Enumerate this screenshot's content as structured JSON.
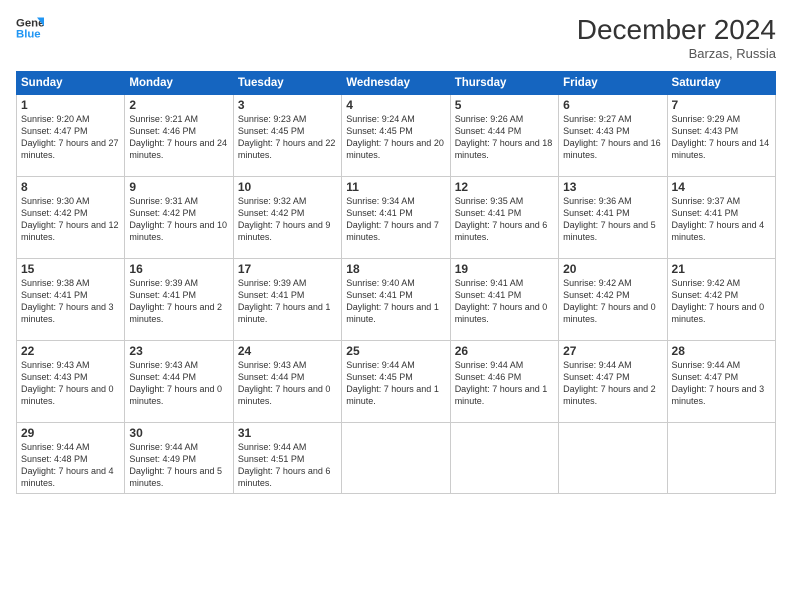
{
  "header": {
    "logo_line1": "General",
    "logo_line2": "Blue",
    "month": "December 2024",
    "location": "Barzas, Russia"
  },
  "weekdays": [
    "Sunday",
    "Monday",
    "Tuesday",
    "Wednesday",
    "Thursday",
    "Friday",
    "Saturday"
  ],
  "weeks": [
    [
      {
        "day": "1",
        "sunrise": "9:20 AM",
        "sunset": "4:47 PM",
        "daylight": "7 hours and 27 minutes."
      },
      {
        "day": "2",
        "sunrise": "9:21 AM",
        "sunset": "4:46 PM",
        "daylight": "7 hours and 24 minutes."
      },
      {
        "day": "3",
        "sunrise": "9:23 AM",
        "sunset": "4:45 PM",
        "daylight": "7 hours and 22 minutes."
      },
      {
        "day": "4",
        "sunrise": "9:24 AM",
        "sunset": "4:45 PM",
        "daylight": "7 hours and 20 minutes."
      },
      {
        "day": "5",
        "sunrise": "9:26 AM",
        "sunset": "4:44 PM",
        "daylight": "7 hours and 18 minutes."
      },
      {
        "day": "6",
        "sunrise": "9:27 AM",
        "sunset": "4:43 PM",
        "daylight": "7 hours and 16 minutes."
      },
      {
        "day": "7",
        "sunrise": "9:29 AM",
        "sunset": "4:43 PM",
        "daylight": "7 hours and 14 minutes."
      }
    ],
    [
      {
        "day": "8",
        "sunrise": "9:30 AM",
        "sunset": "4:42 PM",
        "daylight": "7 hours and 12 minutes."
      },
      {
        "day": "9",
        "sunrise": "9:31 AM",
        "sunset": "4:42 PM",
        "daylight": "7 hours and 10 minutes."
      },
      {
        "day": "10",
        "sunrise": "9:32 AM",
        "sunset": "4:42 PM",
        "daylight": "7 hours and 9 minutes."
      },
      {
        "day": "11",
        "sunrise": "9:34 AM",
        "sunset": "4:41 PM",
        "daylight": "7 hours and 7 minutes."
      },
      {
        "day": "12",
        "sunrise": "9:35 AM",
        "sunset": "4:41 PM",
        "daylight": "7 hours and 6 minutes."
      },
      {
        "day": "13",
        "sunrise": "9:36 AM",
        "sunset": "4:41 PM",
        "daylight": "7 hours and 5 minutes."
      },
      {
        "day": "14",
        "sunrise": "9:37 AM",
        "sunset": "4:41 PM",
        "daylight": "7 hours and 4 minutes."
      }
    ],
    [
      {
        "day": "15",
        "sunrise": "9:38 AM",
        "sunset": "4:41 PM",
        "daylight": "7 hours and 3 minutes."
      },
      {
        "day": "16",
        "sunrise": "9:39 AM",
        "sunset": "4:41 PM",
        "daylight": "7 hours and 2 minutes."
      },
      {
        "day": "17",
        "sunrise": "9:39 AM",
        "sunset": "4:41 PM",
        "daylight": "7 hours and 1 minute."
      },
      {
        "day": "18",
        "sunrise": "9:40 AM",
        "sunset": "4:41 PM",
        "daylight": "7 hours and 1 minute."
      },
      {
        "day": "19",
        "sunrise": "9:41 AM",
        "sunset": "4:41 PM",
        "daylight": "7 hours and 0 minutes."
      },
      {
        "day": "20",
        "sunrise": "9:42 AM",
        "sunset": "4:42 PM",
        "daylight": "7 hours and 0 minutes."
      },
      {
        "day": "21",
        "sunrise": "9:42 AM",
        "sunset": "4:42 PM",
        "daylight": "7 hours and 0 minutes."
      }
    ],
    [
      {
        "day": "22",
        "sunrise": "9:43 AM",
        "sunset": "4:43 PM",
        "daylight": "7 hours and 0 minutes."
      },
      {
        "day": "23",
        "sunrise": "9:43 AM",
        "sunset": "4:44 PM",
        "daylight": "7 hours and 0 minutes."
      },
      {
        "day": "24",
        "sunrise": "9:43 AM",
        "sunset": "4:44 PM",
        "daylight": "7 hours and 0 minutes."
      },
      {
        "day": "25",
        "sunrise": "9:44 AM",
        "sunset": "4:45 PM",
        "daylight": "7 hours and 1 minute."
      },
      {
        "day": "26",
        "sunrise": "9:44 AM",
        "sunset": "4:46 PM",
        "daylight": "7 hours and 1 minute."
      },
      {
        "day": "27",
        "sunrise": "9:44 AM",
        "sunset": "4:47 PM",
        "daylight": "7 hours and 2 minutes."
      },
      {
        "day": "28",
        "sunrise": "9:44 AM",
        "sunset": "4:47 PM",
        "daylight": "7 hours and 3 minutes."
      }
    ],
    [
      {
        "day": "29",
        "sunrise": "9:44 AM",
        "sunset": "4:48 PM",
        "daylight": "7 hours and 4 minutes."
      },
      {
        "day": "30",
        "sunrise": "9:44 AM",
        "sunset": "4:49 PM",
        "daylight": "7 hours and 5 minutes."
      },
      {
        "day": "31",
        "sunrise": "9:44 AM",
        "sunset": "4:51 PM",
        "daylight": "7 hours and 6 minutes."
      },
      null,
      null,
      null,
      null
    ]
  ]
}
